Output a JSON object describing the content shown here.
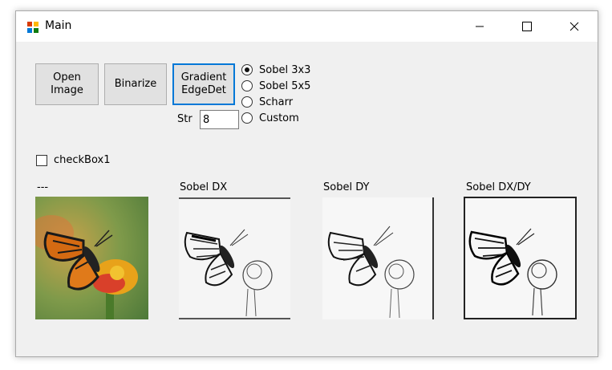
{
  "window": {
    "title": "Main",
    "icon": "app-icon"
  },
  "titlebar_buttons": {
    "minimize": "minimize-icon",
    "maximize": "maximize-icon",
    "close": "close-icon"
  },
  "buttons": {
    "open_image": "Open\nImage",
    "binarize": "Binarize",
    "gradient_edge": "Gradient\nEdgeDet"
  },
  "strength": {
    "label": "Str",
    "value": "8"
  },
  "radios": [
    {
      "label": "Sobel 3x3",
      "checked": true
    },
    {
      "label": "Sobel 5x5",
      "checked": false
    },
    {
      "label": "Scharr",
      "checked": false
    },
    {
      "label": "Custom",
      "checked": false
    }
  ],
  "checkbox": {
    "label": "checkBox1",
    "checked": false
  },
  "images": [
    {
      "caption": "---",
      "kind": "original butterfly photo"
    },
    {
      "caption": "Sobel DX",
      "kind": "edge sketch"
    },
    {
      "caption": "Sobel DY",
      "kind": "edge sketch"
    },
    {
      "caption": "Sobel DX/DY",
      "kind": "edge sketch"
    }
  ],
  "colors": {
    "focus_border": "#0078d7",
    "window_bg": "#f0f0f0",
    "button_bg": "#e1e1e1"
  }
}
